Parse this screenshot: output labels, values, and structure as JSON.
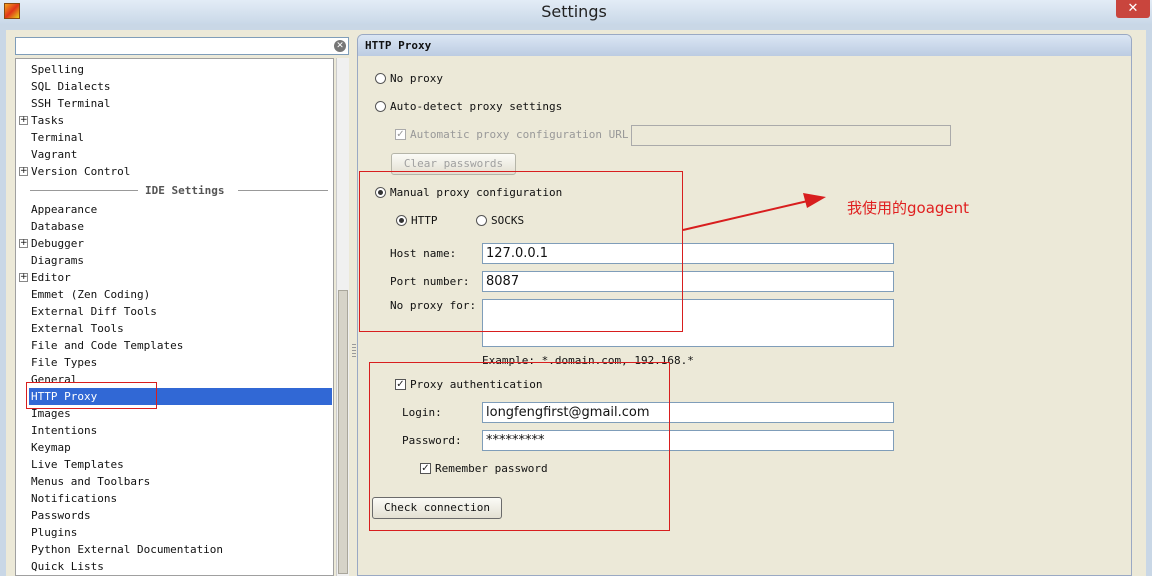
{
  "window": {
    "title": "Settings",
    "close_glyph": "✕"
  },
  "search": {
    "value": "",
    "clear_glyph": "✕"
  },
  "tree": {
    "items_top": [
      "Spelling",
      "SQL Dialects",
      "SSH Terminal",
      "Tasks",
      "Terminal",
      "Vagrant",
      "Version Control"
    ],
    "group_label": "IDE Settings",
    "items_bottom": [
      "Appearance",
      "Database",
      "Debugger",
      "Diagrams",
      "Editor",
      "Emmet (Zen Coding)",
      "External Diff Tools",
      "External Tools",
      "File and Code Templates",
      "File Types",
      "General",
      "HTTP Proxy",
      "Images",
      "Intentions",
      "Keymap",
      "Live Templates",
      "Menus and Toolbars",
      "Notifications",
      "Passwords",
      "Plugins",
      "Python External Documentation",
      "Quick Lists"
    ],
    "expander_glyph": "+",
    "selected": "HTTP Proxy"
  },
  "panel": {
    "title": "HTTP Proxy",
    "no_proxy": "No proxy",
    "auto_detect": "Auto-detect proxy settings",
    "auto_config_url_label": "Automatic proxy configuration URL:",
    "auto_config_url_value": "",
    "clear_passwords": "Clear passwords",
    "manual": "Manual proxy configuration",
    "http": "HTTP",
    "socks": "SOCKS",
    "host_label": "Host name:",
    "host_value": "127.0.0.1",
    "port_label": "Port number:",
    "port_value": "8087",
    "no_proxy_for_label": "No proxy for:",
    "no_proxy_for_value": "",
    "example": "Example: *.domain.com, 192.168.*",
    "proxy_auth": "Proxy authentication",
    "login_label": "Login:",
    "login_value": "longfengfirst@gmail.com",
    "password_label": "Password:",
    "password_value": "*********",
    "remember": "Remember password",
    "check_connection": "Check connection",
    "check_glyph": "✓"
  },
  "annotation": {
    "text": "我使用的goagent",
    "color": "#e02020"
  },
  "colors": {
    "selection": "#3168d5",
    "annotation_red": "#d81e1e"
  }
}
